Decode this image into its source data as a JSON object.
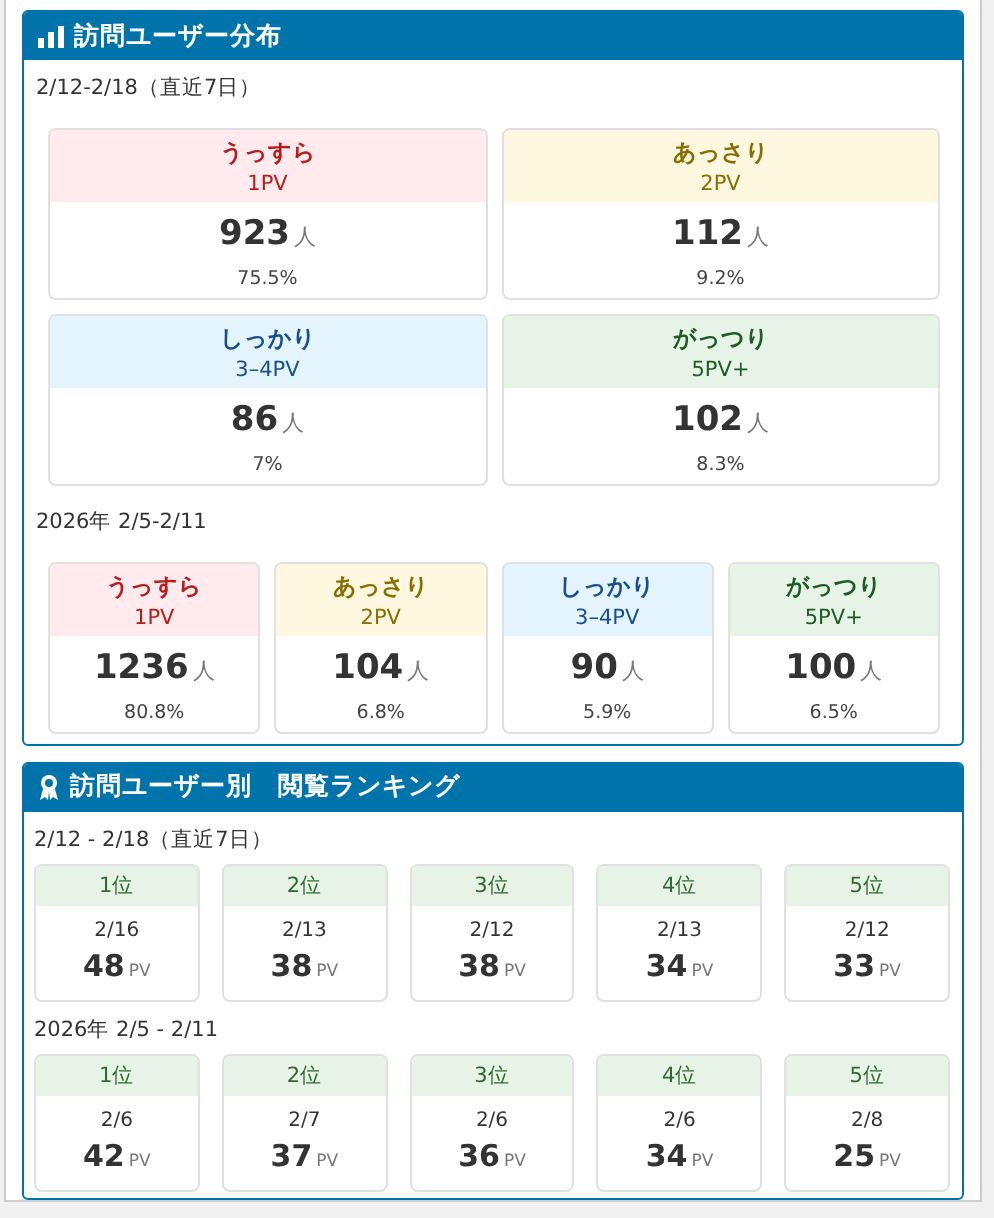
{
  "distribution": {
    "title": "訪問ユーザー分布",
    "periods": [
      {
        "label": "2/12-2/18（直近7日）",
        "kind": "tiles",
        "groups": [
          {
            "kind": "light",
            "name": "うっすら",
            "pv": "1PV",
            "count": "923",
            "unit": "人",
            "percent": "75.5%"
          },
          {
            "kind": "brief",
            "name": "あっさり",
            "pv": "2PV",
            "count": "112",
            "unit": "人",
            "percent": "9.2%"
          },
          {
            "kind": "steady",
            "name": "しっかり",
            "pv": "3–4PV",
            "count": "86",
            "unit": "人",
            "percent": "7%"
          },
          {
            "kind": "heavy",
            "name": "がっつり",
            "pv": "5PV+",
            "count": "102",
            "unit": "人",
            "percent": "8.3%"
          }
        ]
      },
      {
        "label": "2026年 2/5-2/11",
        "kind": "strip",
        "groups": [
          {
            "kind": "light",
            "name": "うっすら",
            "pv": "1PV",
            "count": "1236",
            "unit": "人",
            "percent": "80.8%"
          },
          {
            "kind": "brief",
            "name": "あっさり",
            "pv": "2PV",
            "count": "104",
            "unit": "人",
            "percent": "6.8%"
          },
          {
            "kind": "steady",
            "name": "しっかり",
            "pv": "3–4PV",
            "count": "90",
            "unit": "人",
            "percent": "5.9%"
          },
          {
            "kind": "heavy",
            "name": "がっつり",
            "pv": "5PV+",
            "count": "100",
            "unit": "人",
            "percent": "6.5%"
          }
        ]
      }
    ]
  },
  "ranking": {
    "title": "訪問ユーザー別　閲覧ランキング",
    "periods": [
      {
        "label": "2/12 - 2/18（直近7日）",
        "items": [
          {
            "rank": "1位",
            "date": "2/16",
            "value": "48",
            "unit": "PV"
          },
          {
            "rank": "2位",
            "date": "2/13",
            "value": "38",
            "unit": "PV"
          },
          {
            "rank": "3位",
            "date": "2/12",
            "value": "38",
            "unit": "PV"
          },
          {
            "rank": "4位",
            "date": "2/13",
            "value": "34",
            "unit": "PV"
          },
          {
            "rank": "5位",
            "date": "2/12",
            "value": "33",
            "unit": "PV"
          }
        ]
      },
      {
        "label": "2026年 2/5 - 2/11",
        "items": [
          {
            "rank": "1位",
            "date": "2/6",
            "value": "42",
            "unit": "PV"
          },
          {
            "rank": "2位",
            "date": "2/7",
            "value": "37",
            "unit": "PV"
          },
          {
            "rank": "3位",
            "date": "2/6",
            "value": "36",
            "unit": "PV"
          },
          {
            "rank": "4位",
            "date": "2/6",
            "value": "34",
            "unit": "PV"
          },
          {
            "rank": "5位",
            "date": "2/8",
            "value": "25",
            "unit": "PV"
          }
        ]
      }
    ]
  }
}
